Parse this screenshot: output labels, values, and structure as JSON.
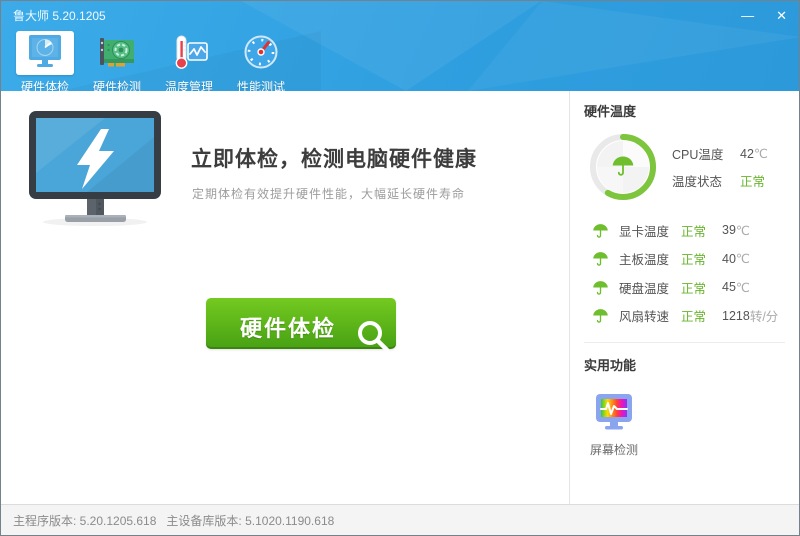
{
  "window": {
    "title": "鲁大师 5.20.1205"
  },
  "titlebar": {
    "minimize_icon": "—",
    "close_icon": "✕"
  },
  "tabs": [
    {
      "label": "硬件体检",
      "icon": "monitor-gauge-icon",
      "active": true
    },
    {
      "label": "硬件检测",
      "icon": "gpu-card-icon",
      "active": false
    },
    {
      "label": "温度管理",
      "icon": "thermometer-chart-icon",
      "active": false
    },
    {
      "label": "性能测试",
      "icon": "speedometer-icon",
      "active": false
    }
  ],
  "main": {
    "heading": "立即体检，检测电脑硬件健康",
    "subheading": "定期体检有效提升硬件性能，大幅延长硬件寿命",
    "button_label": "硬件体检"
  },
  "sidebar": {
    "temp_section_title": "硬件温度",
    "cpu": {
      "label": "CPU温度",
      "value": "42",
      "unit": "℃",
      "status_label": "温度状态",
      "status": "正常"
    },
    "rows": [
      {
        "label": "显卡温度",
        "status": "正常",
        "value": "39",
        "unit": "℃"
      },
      {
        "label": "主板温度",
        "status": "正常",
        "value": "40",
        "unit": "℃"
      },
      {
        "label": "硬盘温度",
        "status": "正常",
        "value": "45",
        "unit": "℃"
      },
      {
        "label": "风扇转速",
        "status": "正常",
        "value": "1218",
        "unit": "转/分"
      }
    ],
    "tools_section_title": "实用功能",
    "tools": [
      {
        "label": "屏幕检测",
        "icon": "screen-test-icon"
      }
    ]
  },
  "statusbar": {
    "program_version": "主程序版本: 5.20.1205.618",
    "device_db_version": "主设备库版本: 5.1020.1190.618"
  },
  "colors": {
    "titlebar_blue": "#2f9fe0",
    "accent_green": "#76c32f",
    "button_green_top": "#74ca20",
    "button_green_bottom": "#47a113",
    "status_green": "#67b52c"
  }
}
